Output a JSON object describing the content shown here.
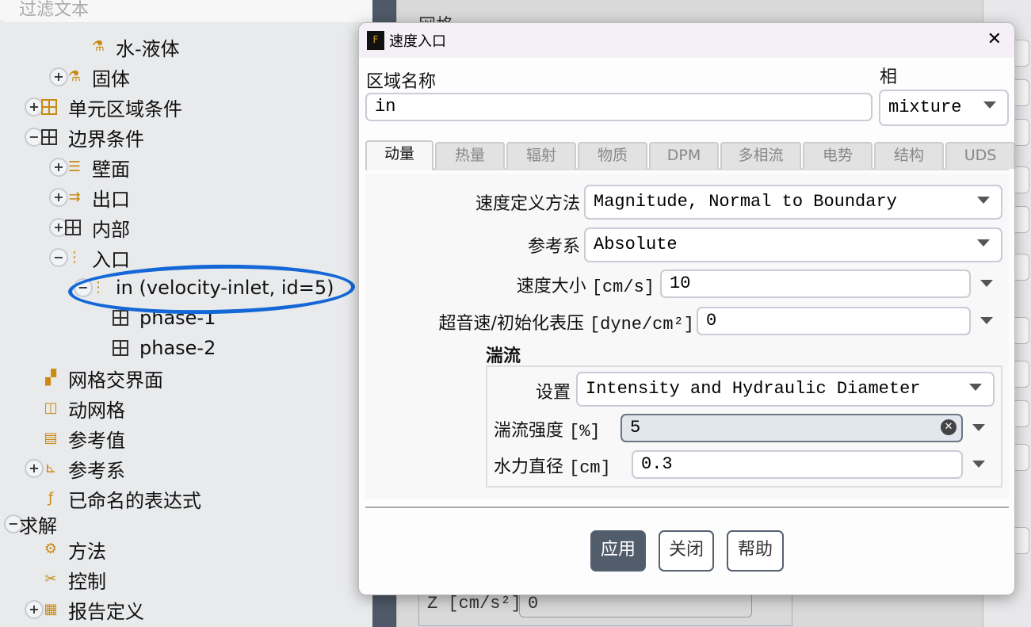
{
  "filter": {
    "placeholder": "过滤文本"
  },
  "tree": [
    {
      "label": "水-液体",
      "icon": "material-icon"
    },
    {
      "label": "固体",
      "icon": "material-icon",
      "toggle": "+"
    },
    {
      "label": "单元区域条件",
      "icon": "grid-icon",
      "toggle": "+"
    },
    {
      "label": "边界条件",
      "icon": "grid-icon",
      "toggle": "−"
    },
    {
      "label": "壁面",
      "icon": "wall-icon",
      "toggle": "+"
    },
    {
      "label": "出口",
      "icon": "outlet-icon",
      "toggle": "+"
    },
    {
      "label": "内部",
      "icon": "grid-icon",
      "toggle": "+"
    },
    {
      "label": "入口",
      "icon": "inlet-icon",
      "toggle": "−"
    },
    {
      "label": "in (velocity-inlet, id=5)",
      "icon": "inlet-icon",
      "toggle": "−"
    },
    {
      "label": "phase-1",
      "icon": "grid-icon"
    },
    {
      "label": "phase-2",
      "icon": "grid-icon"
    },
    {
      "label": "网格交界面",
      "icon": "interface-icon"
    },
    {
      "label": "动网格",
      "icon": "dynamic-mesh-icon"
    },
    {
      "label": "参考值",
      "icon": "clipboard-icon"
    },
    {
      "label": "参考系",
      "icon": "axes-icon",
      "toggle": "+"
    },
    {
      "label": "已命名的表达式",
      "icon": "function-icon"
    },
    {
      "label": "求解",
      "toggle": "−"
    },
    {
      "label": "方法",
      "icon": "gear-icon"
    },
    {
      "label": "控制",
      "icon": "tools-icon"
    },
    {
      "label": "报告定义",
      "icon": "report-icon",
      "toggle": "+"
    }
  ],
  "background": {
    "panel_title": "网格",
    "z_label": "Z [cm/s²]",
    "z_value": "0"
  },
  "dialog": {
    "title": "速度入口",
    "zone_name_label": "区域名称",
    "zone_name": "in",
    "phase_label": "相",
    "phase": "mixture",
    "tabs": [
      "动量",
      "热量",
      "辐射",
      "物质",
      "DPM",
      "多相流",
      "电势",
      "结构",
      "UDS"
    ],
    "active_tab": "动量",
    "fields": {
      "vel_method_label": "速度定义方法",
      "vel_method": "Magnitude, Normal to Boundary",
      "ref_frame_label": "参考系",
      "ref_frame": "Absolute",
      "vel_mag_label": "速度大小",
      "vel_mag_unit": "[cm/s]",
      "vel_mag": "10",
      "pressure_label": "超音速/初始化表压",
      "pressure_unit": "[dyne/cm²]",
      "pressure": "0"
    },
    "turbulence": {
      "title": "湍流",
      "spec_label": "设置",
      "spec": "Intensity and Hydraulic Diameter",
      "intensity_label": "湍流强度",
      "intensity_unit": "[%]",
      "intensity": "5",
      "diameter_label": "水力直径",
      "diameter_unit": "[cm]",
      "diameter": "0.3"
    },
    "buttons": {
      "apply": "应用",
      "close": "关闭",
      "help": "帮助"
    }
  },
  "colors": {
    "annotation": "#1367d6",
    "primary_button": "#525d6b",
    "icon_accent": "#c98a10"
  }
}
